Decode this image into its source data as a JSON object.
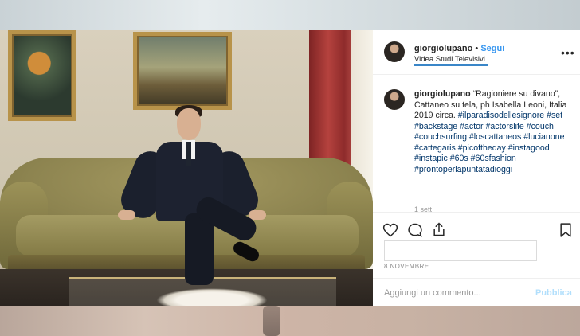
{
  "post": {
    "username": "giorgiolupano",
    "dot": "•",
    "follow_label": "Segui",
    "location": "Videa Studi Televisivi",
    "more_label": "•••",
    "caption_user": "giorgiolupano",
    "caption_text": "“Ragioniere su divano”, Cattaneo su tela, ph Isabella Leoni, Italia 2019 circa.",
    "hashtags": "#ilparadisodellesignore #set #backstage #actor #actorslife #couch #couchsurfing #loscattaneos #lucianone #cattegaris #picoftheday #instagood #instapic #60s #60sfashion #prontoperlapuntatadioggi",
    "likes_peek": "1 sett",
    "date": "8 NOVEMBRE",
    "comment_placeholder": "Aggiungi un commento...",
    "publish_label": "Pubblica"
  },
  "icons": {
    "heart": "heart-icon",
    "comment": "comment-icon",
    "share": "share-icon",
    "save": "bookmark-icon",
    "user_tag": "user-tag-icon"
  },
  "colors": {
    "accent": "#3897f0",
    "publish_disabled": "#b2dffc",
    "location_underline": "#3a86c8"
  }
}
